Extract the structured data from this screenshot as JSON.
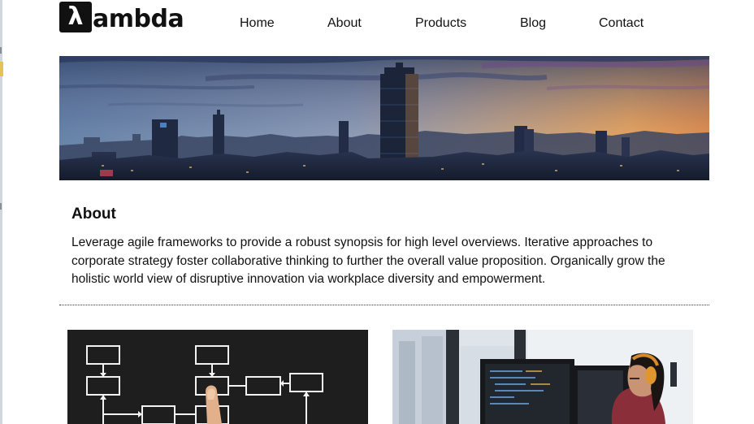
{
  "brand": {
    "logo_mark": "λ",
    "name": "ambda"
  },
  "nav": {
    "items": [
      {
        "label": "Home"
      },
      {
        "label": "About"
      },
      {
        "label": "Products"
      },
      {
        "label": "Blog"
      },
      {
        "label": "Contact"
      }
    ]
  },
  "about": {
    "title": "About",
    "body": "Leverage agile frameworks to provide a robust synopsis for high level overviews. Iterative approaches to corporate strategy foster collaborative thinking to further the overall value proposition. Organically grow the holistic world view of disruptive innovation via workplace diversity and empowerment."
  },
  "colors": {
    "text": "#111111",
    "logo_bg": "#111111",
    "divider": "#333333"
  }
}
